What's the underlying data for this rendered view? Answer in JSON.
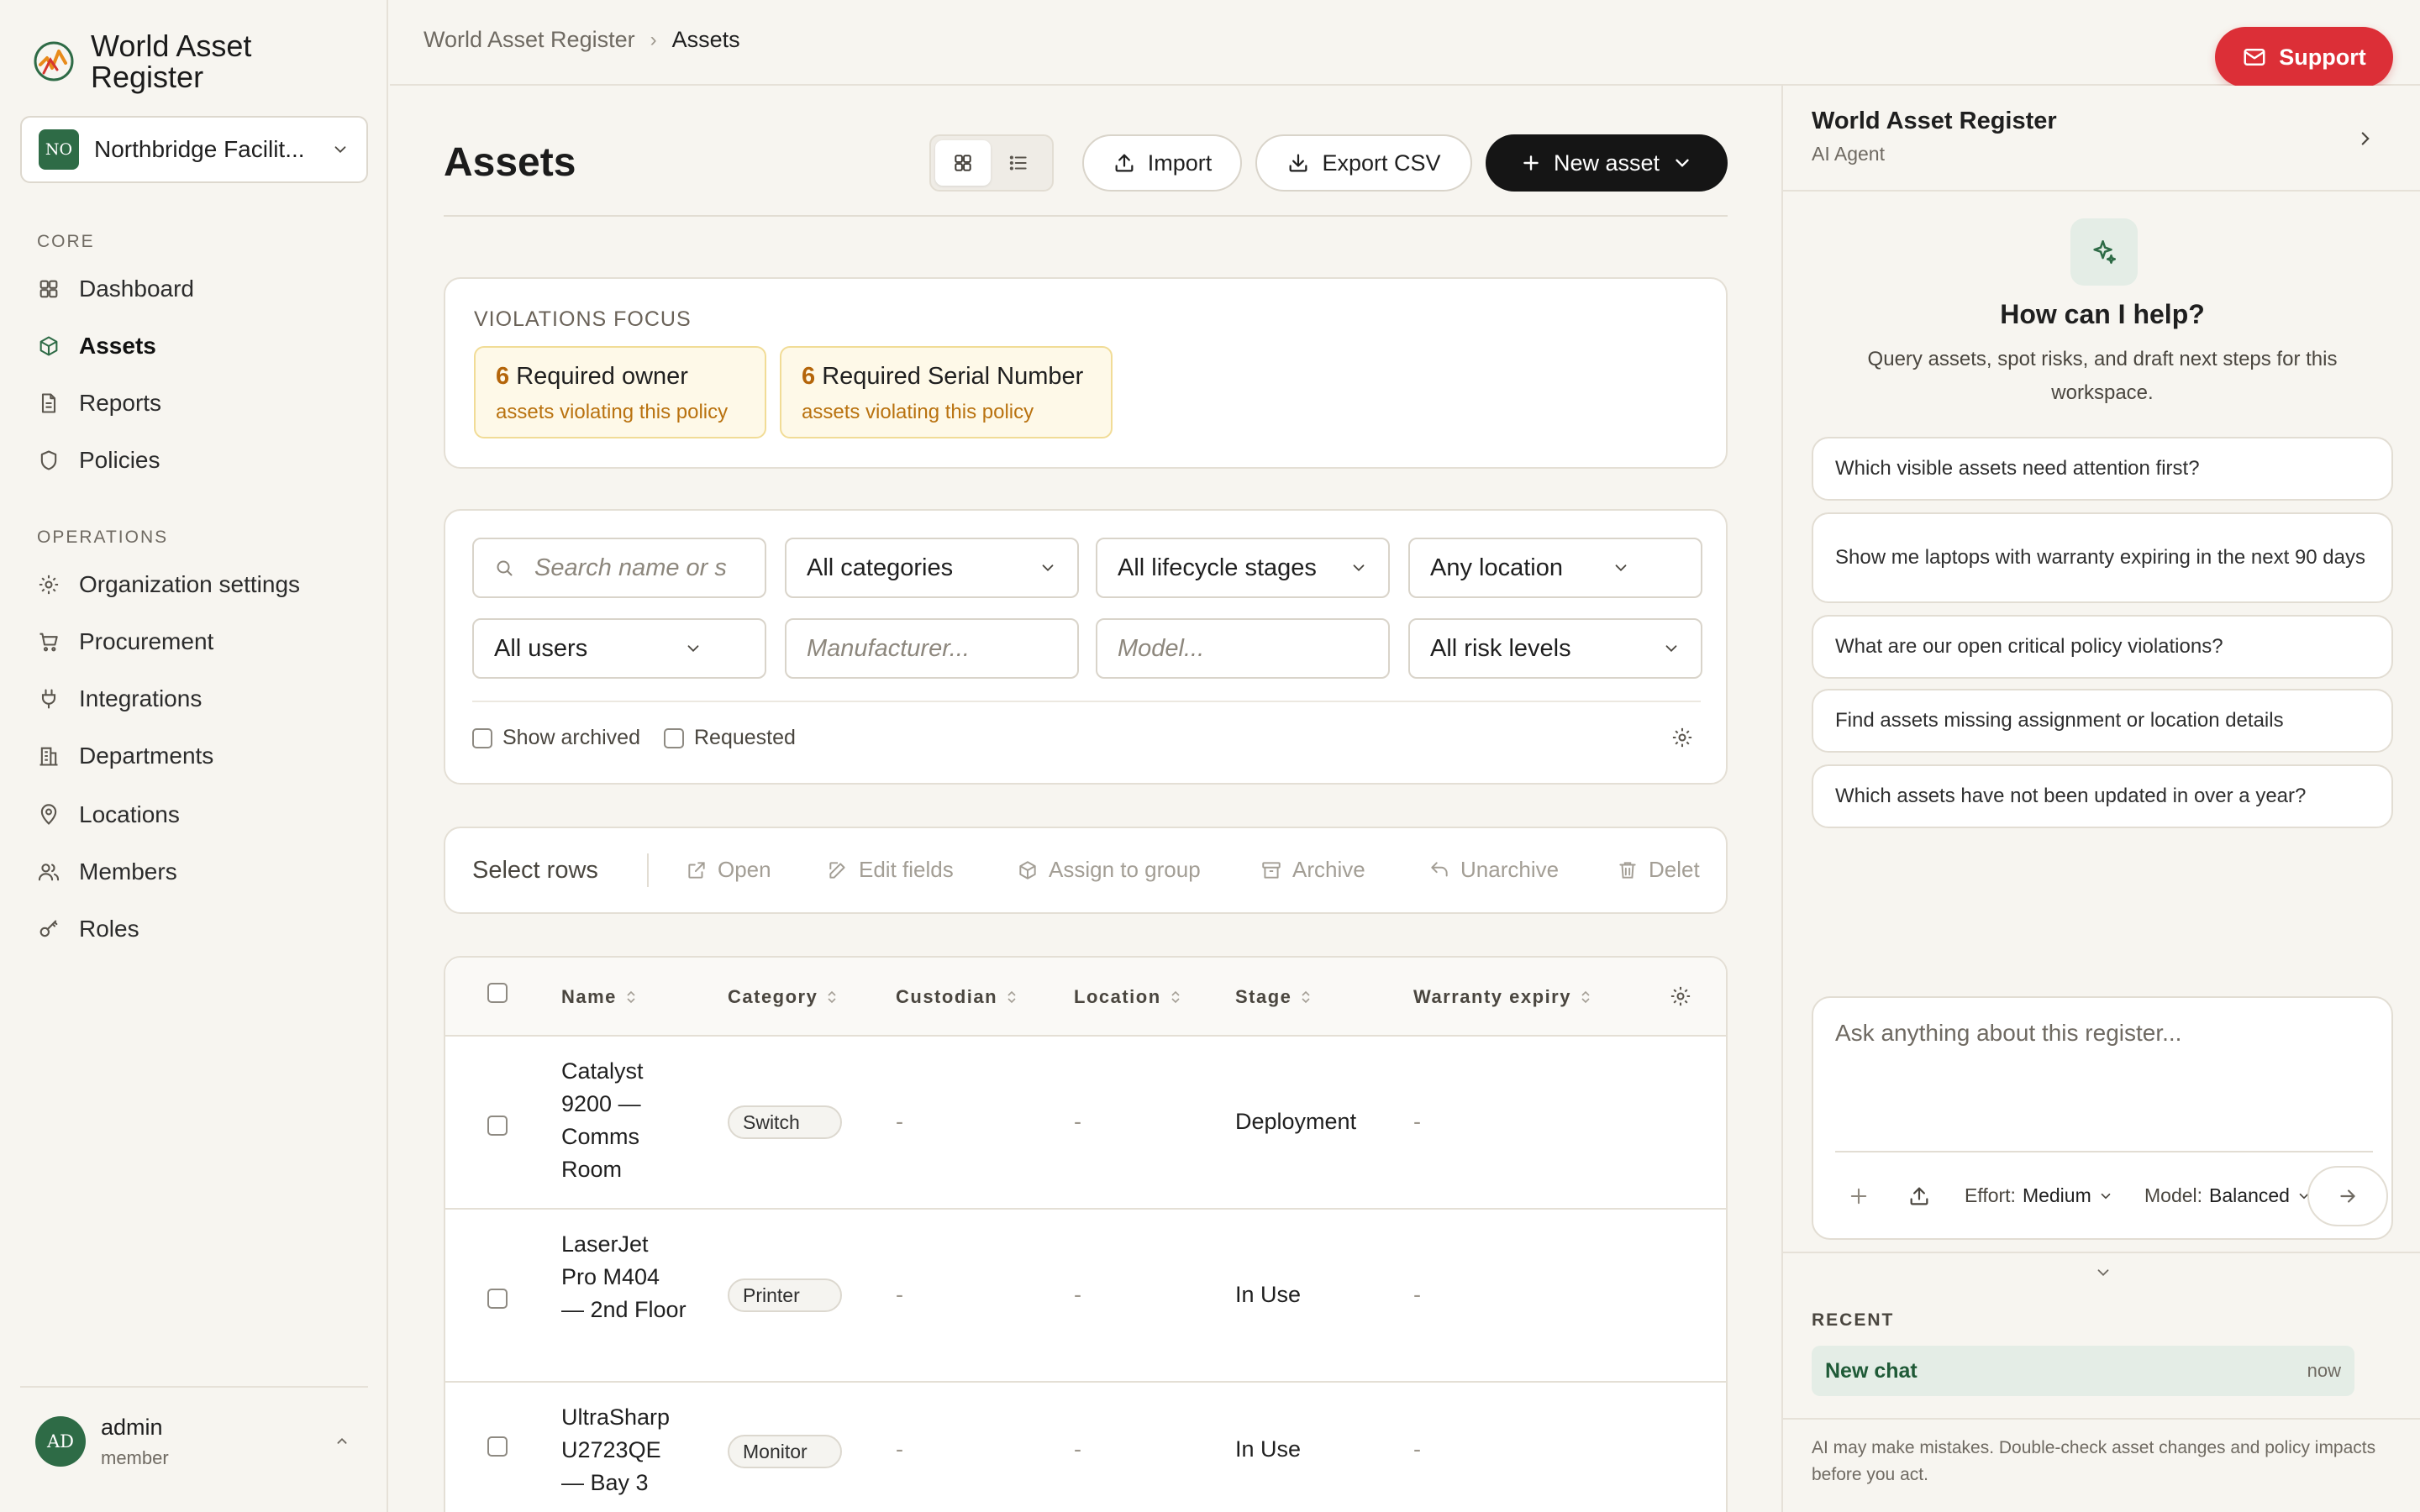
{
  "app": {
    "brand_line1": "World Asset",
    "brand_line2": "Register"
  },
  "org": {
    "badge": "NO",
    "name": "Northbridge Facilit..."
  },
  "sidebar": {
    "core_label": "CORE",
    "core_items": [
      {
        "label": "Dashboard",
        "icon": "grid-icon",
        "active": false
      },
      {
        "label": "Assets",
        "icon": "cube-icon",
        "active": true
      },
      {
        "label": "Reports",
        "icon": "file-icon",
        "active": false
      },
      {
        "label": "Policies",
        "icon": "shield-icon",
        "active": false
      }
    ],
    "ops_label": "OPERATIONS",
    "ops_items": [
      {
        "label": "Organization settings",
        "icon": "gear-icon"
      },
      {
        "label": "Procurement",
        "icon": "cart-icon"
      },
      {
        "label": "Integrations",
        "icon": "plug-icon"
      },
      {
        "label": "Departments",
        "icon": "building-icon"
      },
      {
        "label": "Locations",
        "icon": "pin-icon"
      },
      {
        "label": "Members",
        "icon": "users-icon"
      },
      {
        "label": "Roles",
        "icon": "key-icon"
      }
    ]
  },
  "user": {
    "initials": "AD",
    "name": "admin",
    "role": "member"
  },
  "breadcrumb": {
    "root": "World Asset Register",
    "sep": "›",
    "current": "Assets"
  },
  "support": {
    "label": "Support"
  },
  "header": {
    "title": "Assets",
    "import_label": "Import",
    "export_label": "Export CSV",
    "new_label": "New asset"
  },
  "violations": {
    "title": "VIOLATIONS FOCUS",
    "items": [
      {
        "count": "6",
        "policy": "Required owner",
        "sub": "assets violating this policy"
      },
      {
        "count": "6",
        "policy": "Required Serial Number",
        "sub": "assets violating this policy"
      }
    ]
  },
  "filters": {
    "search_placeholder": "Search name or s",
    "category": "All categories",
    "lifecycle": "All lifecycle stages",
    "location": "Any location",
    "users": "All users",
    "manufacturer_placeholder": "Manufacturer...",
    "model_placeholder": "Model...",
    "risk": "All risk levels",
    "show_archived": "Show archived",
    "requested": "Requested"
  },
  "bulk": {
    "select_label": "Select rows",
    "open": "Open",
    "edit": "Edit fields",
    "assign": "Assign to group",
    "archive": "Archive",
    "unarchive": "Unarchive",
    "delete": "Delet"
  },
  "table": {
    "columns": [
      "Name",
      "Category",
      "Custodian",
      "Location",
      "Stage",
      "Warranty expiry"
    ],
    "rows": [
      {
        "name": "Catalyst 9200 — Comms Room",
        "category": "Switch",
        "custodian": "-",
        "location": "-",
        "stage": "Deployment",
        "warranty": "-"
      },
      {
        "name": "LaserJet Pro M404 — 2nd Floor",
        "category": "Printer",
        "custodian": "-",
        "location": "-",
        "stage": "In Use",
        "warranty": "-"
      },
      {
        "name": "UltraSharp U2723QE — Bay 3",
        "category": "Monitor",
        "custodian": "-",
        "location": "-",
        "stage": "In Use",
        "warranty": "-"
      }
    ]
  },
  "ai": {
    "title": "World Asset Register",
    "subtitle": "AI Agent",
    "help_title": "How can I help?",
    "help_desc": "Query assets, spot risks, and draft next steps for this workspace.",
    "suggestions": [
      "Which visible assets need attention first?",
      "Show me laptops with warranty expiring in the next 90 days",
      "What are our open critical policy violations?",
      "Find assets missing assignment or location details",
      "Which assets have not been updated in over a year?"
    ],
    "input_placeholder": "Ask anything about this register...",
    "effort_label": "Effort:",
    "effort_value": "Medium",
    "model_label": "Model:",
    "model_value": "Balanced",
    "recent_label": "RECENT",
    "recent_items": [
      {
        "name": "New chat",
        "time": "now"
      }
    ],
    "disclaimer": "AI may make mistakes. Double-check asset changes and policy impacts before you act."
  },
  "colors": {
    "accent": "#2e6b46",
    "support": "#dc2f37",
    "warning": "#b4650a",
    "primary_btn": "#151515"
  }
}
